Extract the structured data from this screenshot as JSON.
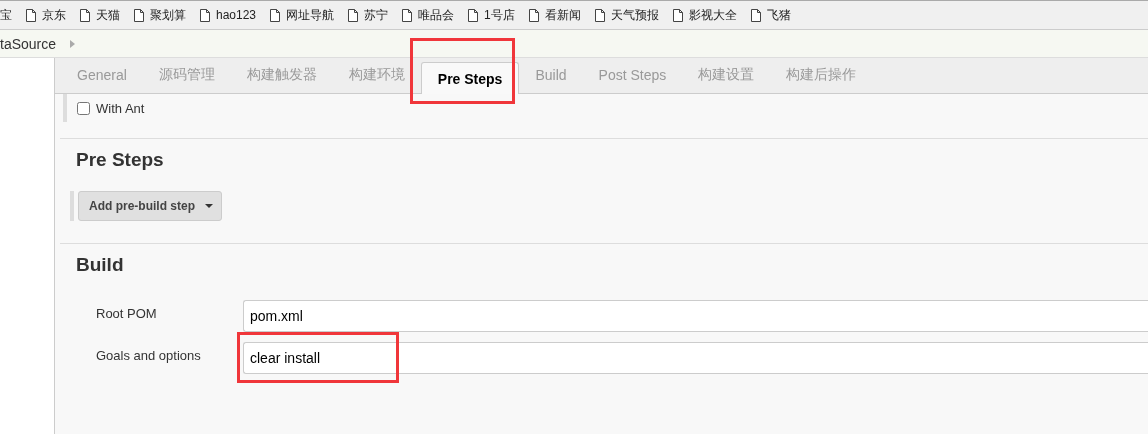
{
  "bookmarks": [
    "宝",
    "京东",
    "天猫",
    "聚划算",
    "hao123",
    "网址导航",
    "苏宁",
    "唯品会",
    "1号店",
    "看新闻",
    "天气预报",
    "影视大全",
    "飞猪"
  ],
  "breadcrumb": "taSource",
  "tabs": [
    {
      "label": "General",
      "selected": false
    },
    {
      "label": "源码管理",
      "selected": false
    },
    {
      "label": "构建触发器",
      "selected": false
    },
    {
      "label": "构建环境",
      "selected": false
    },
    {
      "label": "Pre Steps",
      "selected": true
    },
    {
      "label": "Build",
      "selected": false
    },
    {
      "label": "Post Steps",
      "selected": false
    },
    {
      "label": "构建设置",
      "selected": false
    },
    {
      "label": "构建后操作",
      "selected": false
    }
  ],
  "with_ant": {
    "label": "With Ant",
    "checked": false
  },
  "pre_steps": {
    "title": "Pre Steps",
    "button": "Add pre-build step"
  },
  "build": {
    "title": "Build",
    "fields": [
      {
        "label": "Root POM",
        "value": "pom.xml"
      },
      {
        "label": "Goals and options",
        "value": "clear install"
      }
    ]
  }
}
